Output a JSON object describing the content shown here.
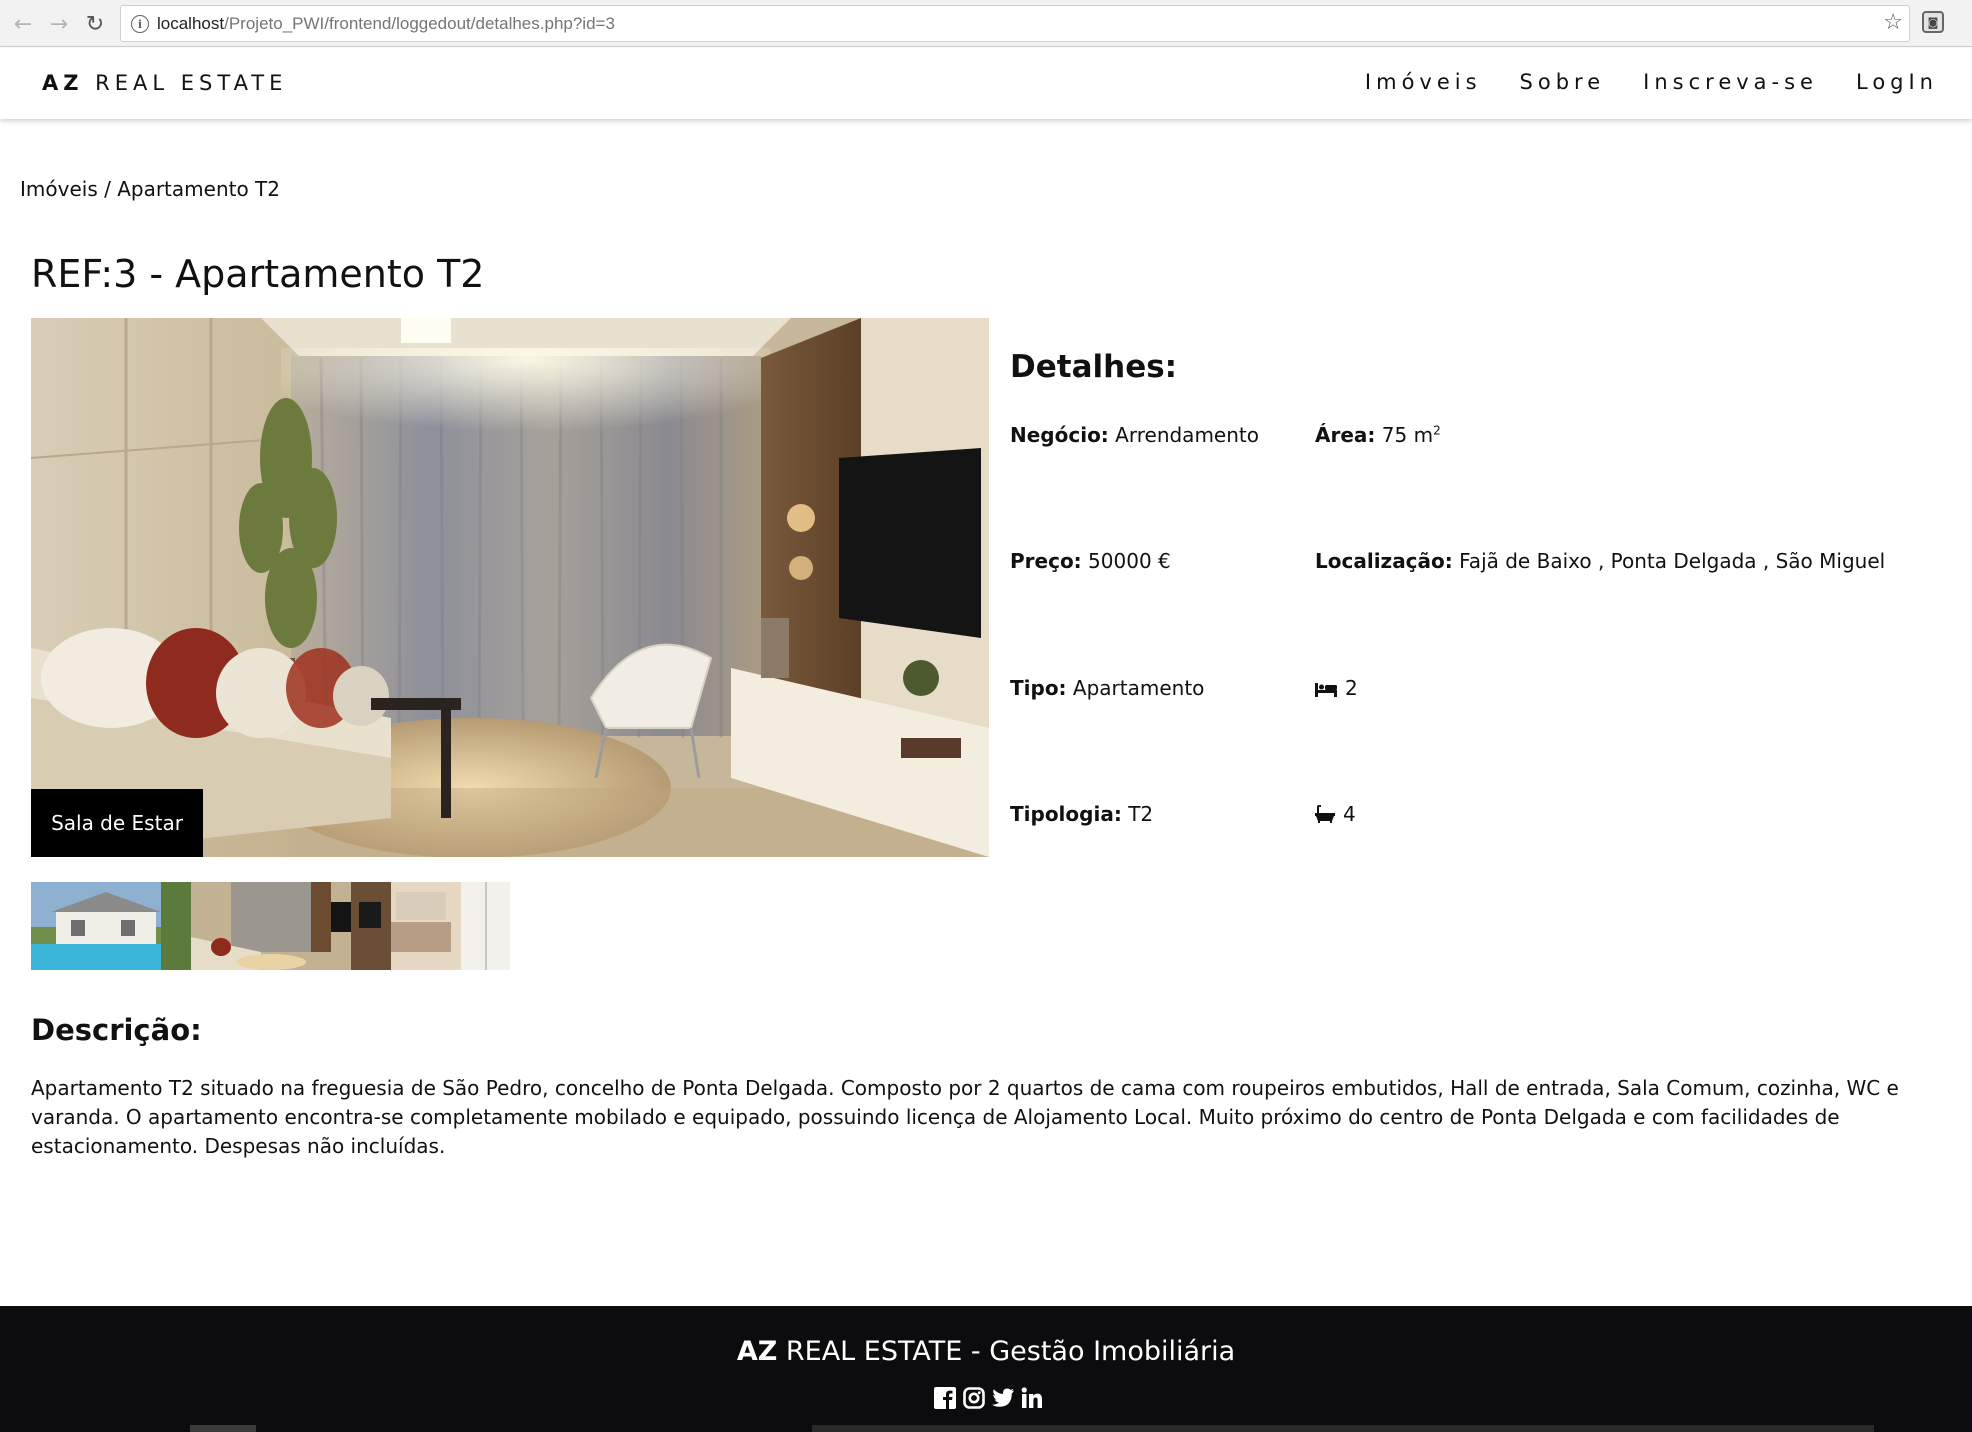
{
  "browser": {
    "url_host": "localhost",
    "url_path": "/Projeto_PWI/frontend/loggedout/detalhes.php?id=3"
  },
  "navbar": {
    "brand_bold": "AZ",
    "brand_rest": "REAL ESTATE",
    "menu": [
      "Imóveis",
      "Sobre",
      "Inscreva-se",
      "LogIn"
    ]
  },
  "breadcrumb": {
    "parent": "Imóveis",
    "separator": "/",
    "current": "Apartamento T2"
  },
  "property": {
    "title": "REF:3 - Apartamento T2",
    "photo_caption": "Sala de Estar",
    "details_heading": "Detalhes:",
    "negocio_label": "Negócio:",
    "negocio_value": "Arrendamento",
    "area_label": "Área:",
    "area_value": "75 m",
    "area_unit_sup": "2",
    "preco_label": "Preço:",
    "preco_value": "50000 €",
    "localizacao_label": "Localização:",
    "localizacao_value": "Fajã de Baixo , Ponta Delgada , São Miguel",
    "tipo_label": "Tipo:",
    "tipo_value": "Apartamento",
    "quartos_value": "2",
    "tipologia_label": "Tipologia:",
    "tipologia_value": "T2",
    "wc_value": "4",
    "icons": {
      "bedrooms": "bed-icon",
      "bathrooms": "bath-icon"
    }
  },
  "description": {
    "heading": "Descrição:",
    "text": "Apartamento T2 situado na freguesia de São Pedro, concelho de Ponta Delgada. Composto por 2 quartos de cama com roupeiros embutidos, Hall de entrada, Sala Comum, cozinha, WC e varanda. O apartamento encontra-se completamente mobilado e equipado, possuindo licença de Alojamento Local. Muito próximo do centro de Ponta Delgada e com facilidades de estacionamento. Despesas não incluídas."
  },
  "footer": {
    "brand_bold": "AZ",
    "brand_rest": "REAL ESTATE - Gestão Imobiliária",
    "social_icons": [
      "facebook-icon",
      "instagram-icon",
      "twitter-icon",
      "linkedin-icon"
    ]
  }
}
